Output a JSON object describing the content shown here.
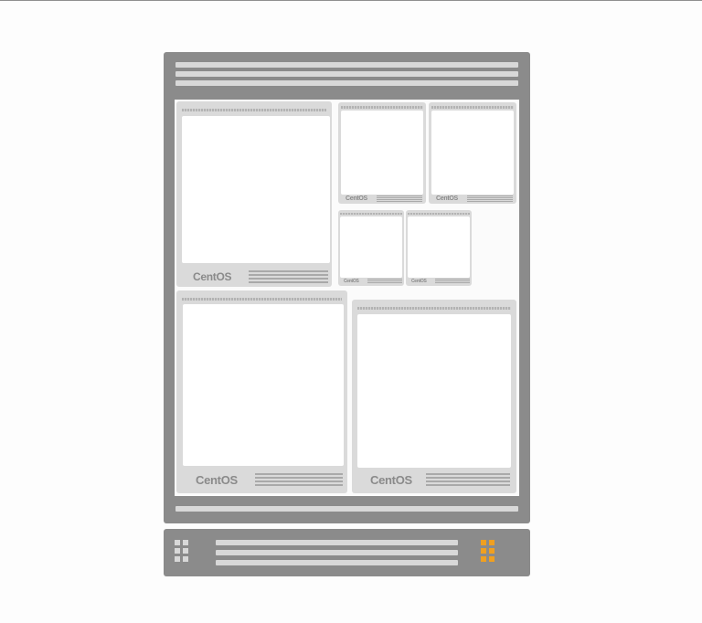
{
  "diagram": {
    "server_logo": "CentOS",
    "colors": {
      "chassis": "#8b8b8b",
      "stripe": "#d8d8d8",
      "card": "#dadada",
      "screen": "#ffffff",
      "logo_text": "#8a8a8a",
      "grid_inactive": "#d8d8d8",
      "grid_active": "#f0a020"
    },
    "icons": {
      "left_grid": "grid-icon",
      "right_grid": "grid-icon-active"
    }
  }
}
